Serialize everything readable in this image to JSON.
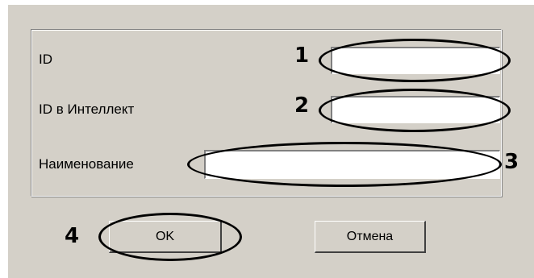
{
  "form": {
    "id_label": "ID",
    "id_value": "",
    "intellect_id_label": "ID в Интеллект",
    "intellect_id_value": "",
    "name_label": "Наименование",
    "name_value": ""
  },
  "buttons": {
    "ok_label": "OK",
    "cancel_label": "Отмена"
  },
  "callouts": {
    "one": "1",
    "two": "2",
    "three": "3",
    "four": "4"
  }
}
